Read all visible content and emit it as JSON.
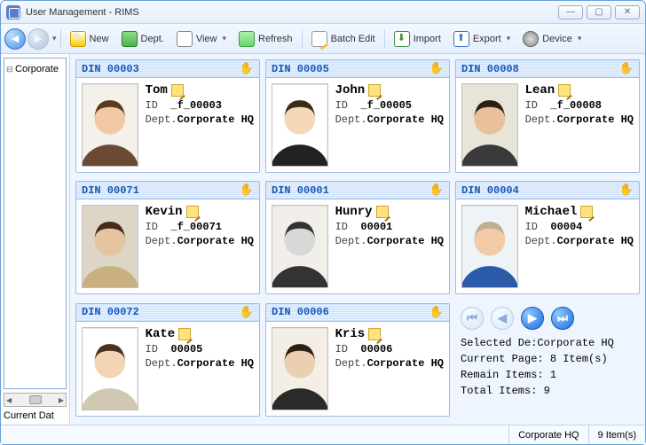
{
  "window": {
    "title": "User Management - RIMS"
  },
  "toolbar": {
    "new": "New",
    "dept": "Dept.",
    "view": "View",
    "refresh": "Refresh",
    "batch": "Batch Edit",
    "import": "Import",
    "export": "Export",
    "device": "Device"
  },
  "sidebar": {
    "tree_root": "Corporate",
    "current_data_label": "Current Dat"
  },
  "id_label": "ID",
  "dept_label": "Dept.",
  "users": [
    {
      "din": "DIN 00003",
      "name": "Tom",
      "id": "_f_00003",
      "dept": "Corporate HQ"
    },
    {
      "din": "DIN 00005",
      "name": "John",
      "id": "_f_00005",
      "dept": "Corporate HQ"
    },
    {
      "din": "DIN 00008",
      "name": "Lean",
      "id": "_f_00008",
      "dept": "Corporate HQ"
    },
    {
      "din": "DIN 00071",
      "name": "Kevin",
      "id": "_f_00071",
      "dept": "Corporate HQ"
    },
    {
      "din": "DIN 00001",
      "name": "Hunry",
      "id": "00001",
      "dept": "Corporate HQ"
    },
    {
      "din": "DIN 00004",
      "name": "Michael",
      "id": "00004",
      "dept": "Corporate HQ"
    },
    {
      "din": "DIN 00072",
      "name": "Kate",
      "id": "00005",
      "dept": "Corporate HQ"
    },
    {
      "din": "DIN 00006",
      "name": "Kris",
      "id": "00006",
      "dept": "Corporate HQ"
    }
  ],
  "pager": {
    "selected_dept_label": "Selected De:",
    "selected_dept_value": "Corporate HQ",
    "current_page_label": "Current Page:",
    "current_page_value": "8 Item(s)",
    "remain_label": "Remain Items:",
    "remain_value": "1",
    "total_label": "Total Items:",
    "total_value": "9"
  },
  "status": {
    "dept": "Corporate HQ",
    "count": "9 Item(s)"
  }
}
